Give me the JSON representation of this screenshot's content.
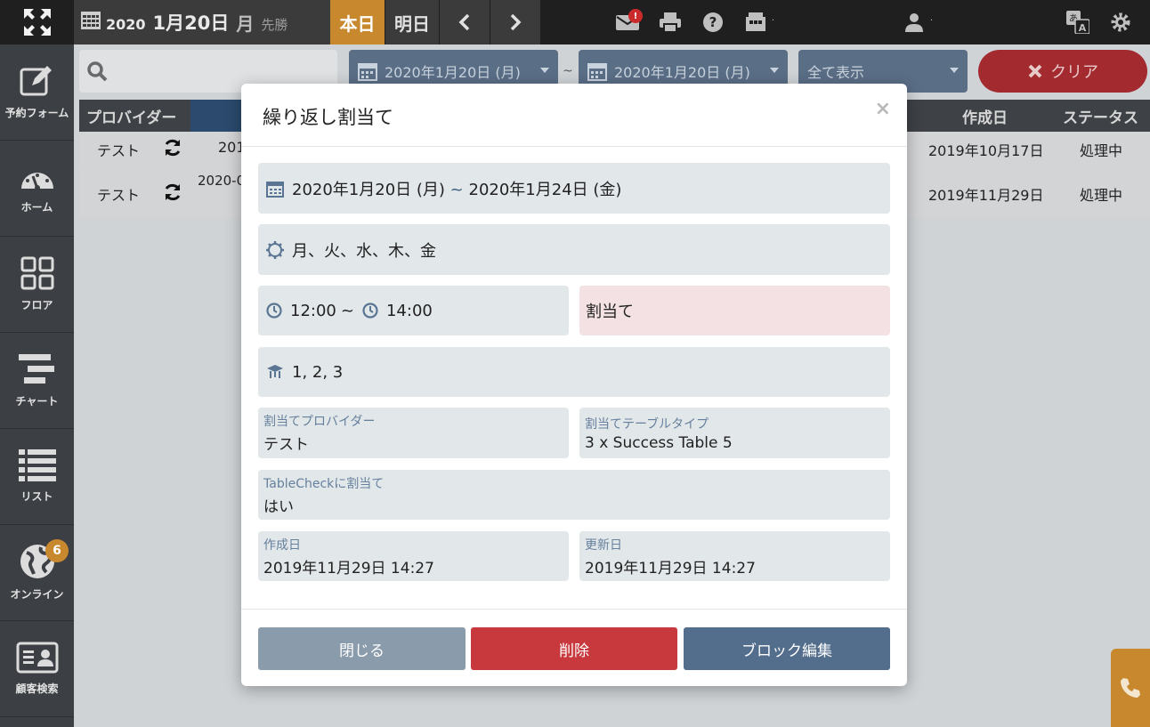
{
  "topbar": {
    "year": "2020",
    "month_day": "1月20日",
    "weekday": "月",
    "rokuyo": "先勝",
    "today_label": "本日",
    "tomorrow_label": "明日",
    "mail_badge": "!",
    "icons": [
      "grid-logo-icon",
      "calendar-icon",
      "chevron-left-icon",
      "chevron-right-icon",
      "mail-icon",
      "print-icon",
      "help-icon",
      "register-icon",
      "user-icon",
      "translate-icon",
      "gear-icon"
    ]
  },
  "sidebar": {
    "items": [
      {
        "label": "予約フォーム",
        "icon": "edit-icon"
      },
      {
        "label": "ホーム",
        "icon": "dashboard-icon"
      },
      {
        "label": "フロア",
        "icon": "floor-grid-icon"
      },
      {
        "label": "チャート",
        "icon": "chart-bars-icon"
      },
      {
        "label": "リスト",
        "icon": "list-icon"
      },
      {
        "label": "オンライン",
        "icon": "globe-icon",
        "badge": "6"
      },
      {
        "label": "顧客検索",
        "icon": "id-card-icon"
      }
    ]
  },
  "filters": {
    "date_from": "2020年1月20日 (月)",
    "tilde": "~",
    "date_to": "2020年1月20日 (月)",
    "show_all": "全て表示",
    "clear": "クリア"
  },
  "table": {
    "headers": {
      "provider": "プロバイダー",
      "created": "作成日",
      "status": "ステータス"
    },
    "rows": [
      {
        "provider": "テスト",
        "date_fragment": "201",
        "created": "2019年10月17日",
        "status": "処理中"
      },
      {
        "provider": "テスト",
        "date_fragment": "2020-0",
        "created": "2019年11月29日",
        "status": "処理中"
      }
    ]
  },
  "modal": {
    "title": "繰り返し割当て",
    "close": "×",
    "date_start": "2020年1月20日 (月)",
    "date_tilde": "~",
    "date_end": "2020年1月24日 (金)",
    "days": "月、火、水、木、金",
    "time_start": "12:00",
    "time_tilde": "~",
    "time_end": "14:00",
    "assign_label": "割当て",
    "tables": "1, 2, 3",
    "provider_label": "割当てプロバイダー",
    "provider_value": "テスト",
    "table_type_label": "割当てテーブルタイプ",
    "table_type_value": "3 x Success Table 5",
    "tablecheck_label": "TableCheckに割当て",
    "tablecheck_value": "はい",
    "created_label": "作成日",
    "created_value": "2019年11月29日 14:27",
    "updated_label": "更新日",
    "updated_value": "2019年11月29日 14:27",
    "btn_close": "閉じる",
    "btn_delete": "削除",
    "btn_edit": "ブロック編集"
  },
  "colors": {
    "accent": "#c8882d",
    "danger": "#c8393e",
    "primary": "#536d8c",
    "muted": "#8a9bac"
  }
}
